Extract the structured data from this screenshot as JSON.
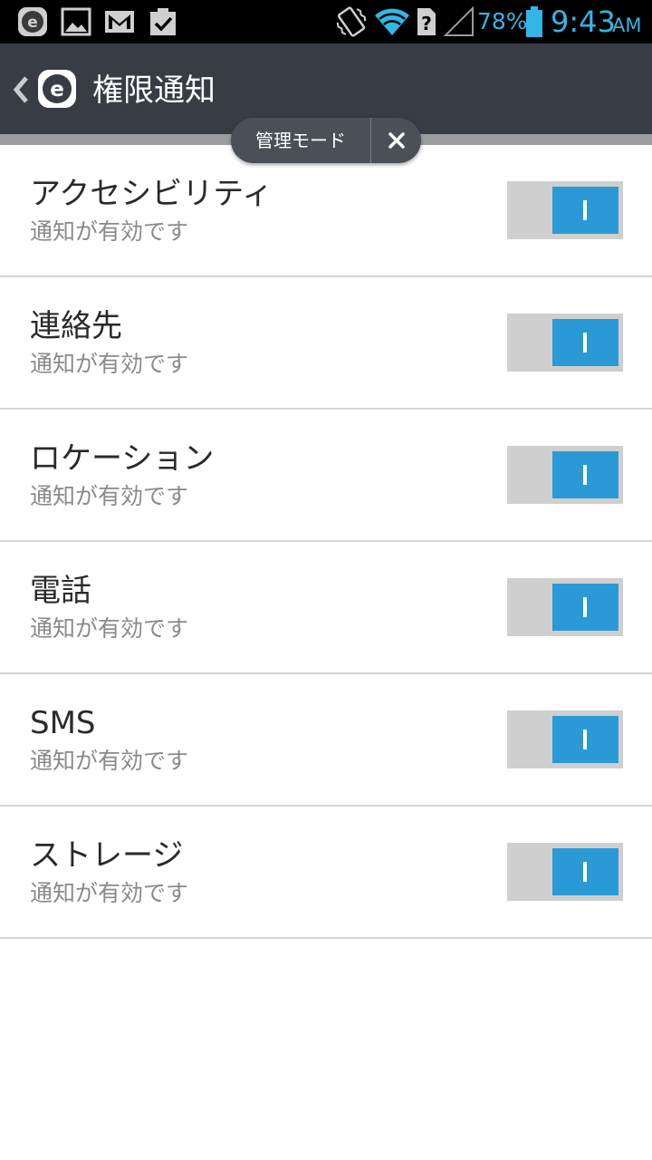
{
  "status_bar": {
    "battery": "78%",
    "time": "9:43",
    "ampm": "AM",
    "icons": [
      "eset-notification-icon",
      "image-icon",
      "gmail-icon",
      "clipboard-check-icon",
      "vibrate-icon",
      "wifi-icon",
      "no-sim-icon",
      "signal-icon",
      "battery-icon"
    ],
    "accent_color": "#33b5e5"
  },
  "action_bar": {
    "title": "権限通知",
    "icons": [
      "back-chevron-icon",
      "eset-logo-icon"
    ]
  },
  "admin_mode": {
    "label": "管理モード",
    "close_icon": "close-icon"
  },
  "permissions": [
    {
      "title": "アクセシビリティ",
      "status": "通知が有効です",
      "enabled": true
    },
    {
      "title": "連絡先",
      "status": "通知が有効です",
      "enabled": true
    },
    {
      "title": "ロケーション",
      "status": "通知が有効です",
      "enabled": true
    },
    {
      "title": "電話",
      "status": "通知が有効です",
      "enabled": true
    },
    {
      "title": "SMS",
      "status": "通知が有効です",
      "enabled": true
    },
    {
      "title": "ストレージ",
      "status": "通知が有効です",
      "enabled": true
    }
  ],
  "colors": {
    "toggle_on": "#2a9ad6",
    "action_bar": "#383c44"
  }
}
